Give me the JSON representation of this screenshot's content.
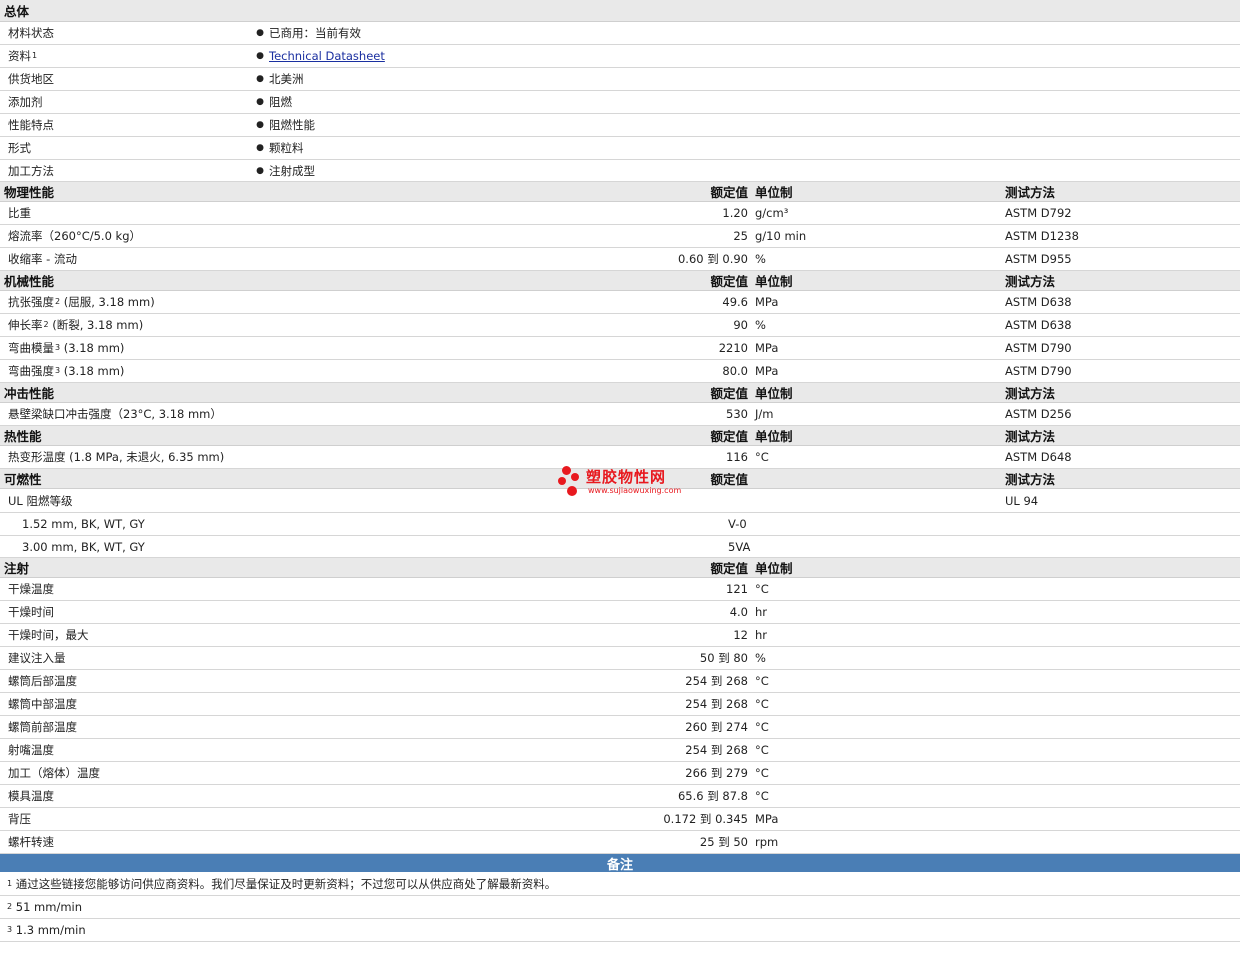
{
  "general": {
    "title": "总体",
    "rows": [
      {
        "label": "材料状态",
        "value": "已商用：当前有效"
      },
      {
        "label": "资料",
        "sup": "1",
        "value": "Technical Datasheet",
        "link": true
      },
      {
        "label": "供货地区",
        "value": "北美洲"
      },
      {
        "label": "添加剂",
        "value": "阻燃"
      },
      {
        "label": "性能特点",
        "value": "阻燃性能"
      },
      {
        "label": "形式",
        "value": "颗粒料"
      },
      {
        "label": "加工方法",
        "value": "注射成型"
      }
    ]
  },
  "columns": {
    "nominal": "额定值",
    "unit": "单位制",
    "method": "测试方法"
  },
  "physical": {
    "title": "物理性能",
    "rows": [
      {
        "name": "比重",
        "value": "1.20",
        "unit": "g/cm³",
        "method": "ASTM D792"
      },
      {
        "name": "熔流率（260°C/5.0 kg）",
        "value": "25",
        "unit": "g/10 min",
        "method": "ASTM D1238"
      },
      {
        "name": "收缩率 - 流动",
        "value": "0.60 到 0.90",
        "unit": "%",
        "method": "ASTM D955"
      }
    ]
  },
  "mechanical": {
    "title": "机械性能",
    "rows": [
      {
        "name": "抗张强度",
        "sup": "2",
        "cond": "(屈服, 3.18 mm)",
        "value": "49.6",
        "unit": "MPa",
        "method": "ASTM D638"
      },
      {
        "name": "伸长率",
        "sup": "2",
        "cond": "(断裂, 3.18 mm)",
        "value": "90",
        "unit": "%",
        "method": "ASTM D638"
      },
      {
        "name": "弯曲模量",
        "sup": "3",
        "cond": "(3.18 mm)",
        "value": "2210",
        "unit": "MPa",
        "method": "ASTM D790"
      },
      {
        "name": "弯曲强度",
        "sup": "3",
        "cond": "(3.18 mm)",
        "value": "80.0",
        "unit": "MPa",
        "method": "ASTM D790"
      }
    ]
  },
  "impact": {
    "title": "冲击性能",
    "rows": [
      {
        "name": "悬壁梁缺口冲击强度（23°C, 3.18 mm）",
        "value": "530",
        "unit": "J/m",
        "method": "ASTM D256"
      }
    ]
  },
  "thermal": {
    "title": "热性能",
    "rows": [
      {
        "name": "热变形温度 (1.8 MPa, 未退火, 6.35 mm)",
        "value": "116",
        "unit": "°C",
        "method": "ASTM D648"
      }
    ]
  },
  "flammability": {
    "title": "可燃性",
    "rows": [
      {
        "name": "UL 阻燃等级",
        "value": "",
        "unit": "",
        "method": "UL 94"
      },
      {
        "name": "1.52 mm, BK, WT, GY",
        "value": "V-0"
      },
      {
        "name": "3.00 mm, BK, WT, GY",
        "value": "5VA"
      }
    ]
  },
  "injection": {
    "title": "注射",
    "rows": [
      {
        "name": "干燥温度",
        "value": "121",
        "unit": "°C"
      },
      {
        "name": "干燥时间",
        "value": "4.0",
        "unit": "hr"
      },
      {
        "name": "干燥时间，最大",
        "value": "12",
        "unit": "hr"
      },
      {
        "name": "建议注入量",
        "value": "50 到 80",
        "unit": "%"
      },
      {
        "name": "螺筒后部温度",
        "value": "254 到 268",
        "unit": "°C"
      },
      {
        "name": "螺筒中部温度",
        "value": "254 到 268",
        "unit": "°C"
      },
      {
        "name": "螺筒前部温度",
        "value": "260 到 274",
        "unit": "°C"
      },
      {
        "name": "射嘴温度",
        "value": "254 到 268",
        "unit": "°C"
      },
      {
        "name": "加工（熔体）温度",
        "value": "266 到 279",
        "unit": "°C"
      },
      {
        "name": "模具温度",
        "value": "65.6 到 87.8",
        "unit": "°C"
      },
      {
        "name": "背压",
        "value": "0.172 到 0.345",
        "unit": "MPa"
      },
      {
        "name": "螺杆转速",
        "value": "25 到 50",
        "unit": "rpm"
      }
    ]
  },
  "notes": {
    "title": "备注",
    "items": [
      {
        "sup": "1",
        "text": "通过这些链接您能够访问供应商资料。我们尽量保证及时更新资料；不过您可以从供应商处了解最新资料。"
      },
      {
        "sup": "2",
        "text": "51 mm/min"
      },
      {
        "sup": "3",
        "text": "1.3 mm/min"
      }
    ]
  },
  "watermark": {
    "title": "塑胶物性网",
    "url": "www.sujiaowuxing.com",
    "color": "#e8191f"
  },
  "colors": {
    "header_bg": "#e9e9e9",
    "notes_bg": "#4a7eb5",
    "link": "#1a2fa0"
  }
}
